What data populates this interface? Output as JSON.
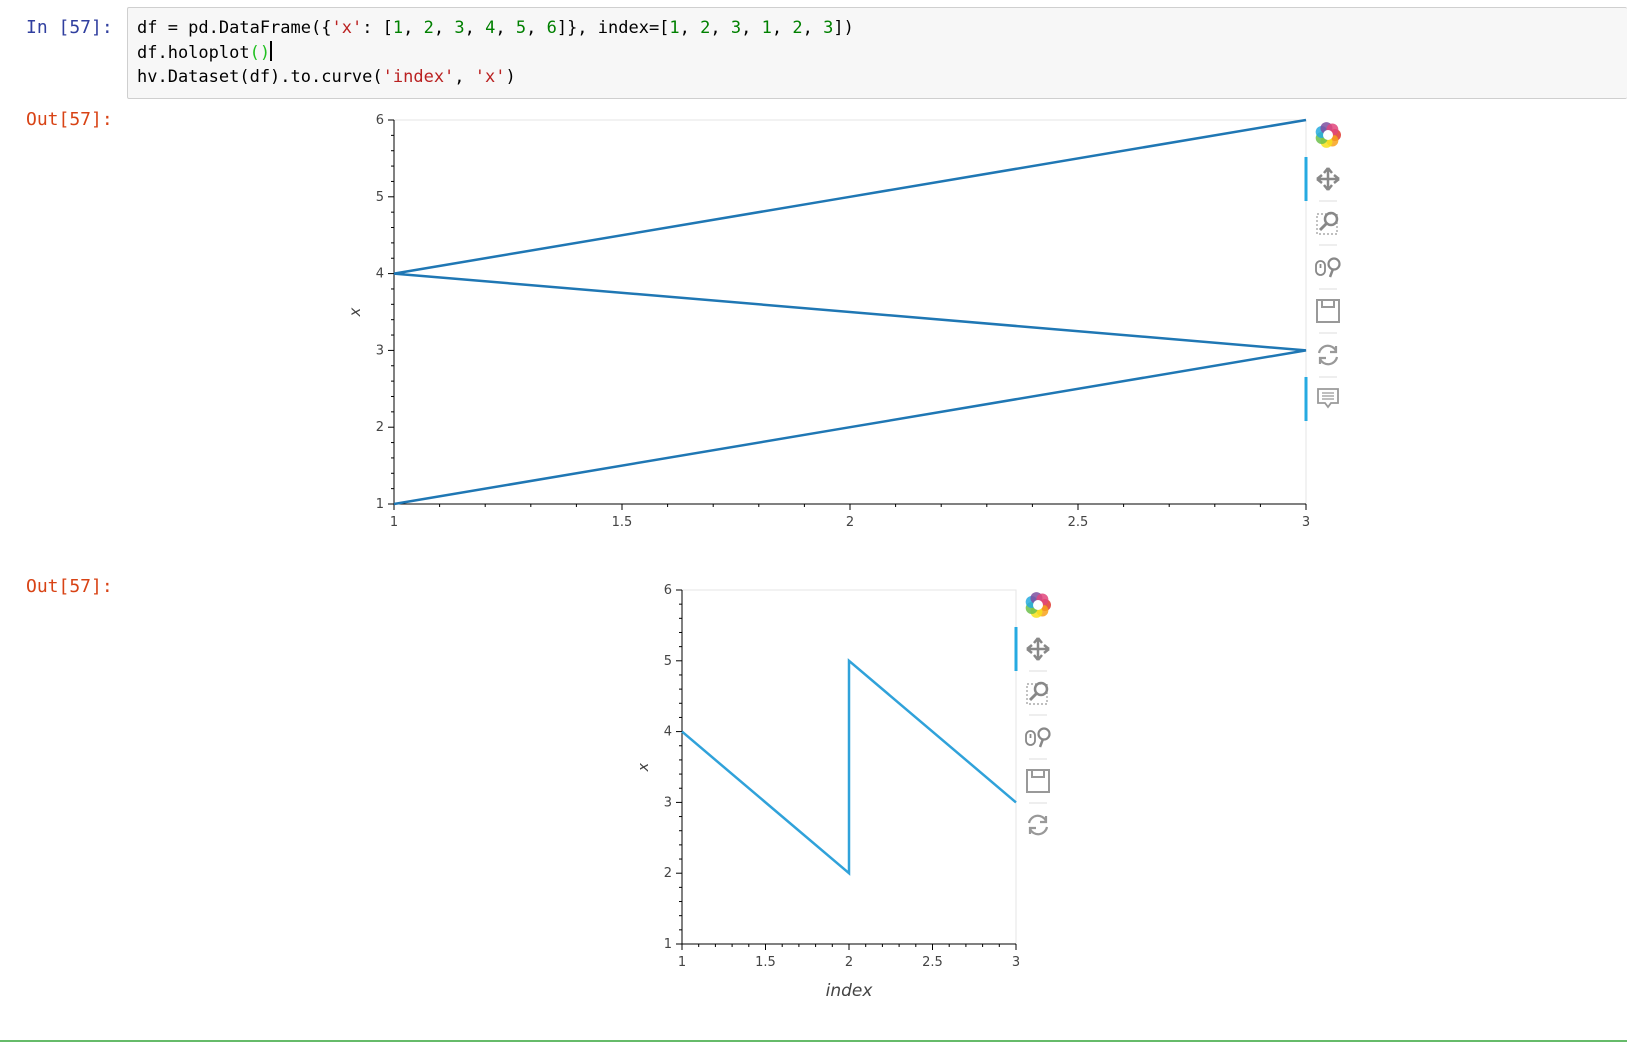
{
  "cell": {
    "in_prompt": "In [57]:",
    "code": {
      "l1_a": "df = pd.DataFrame({",
      "l1_str": "'x'",
      "l1_b": ": [",
      "l1_n1": "1",
      "l1_n2": "2",
      "l1_n3": "3",
      "l1_n4": "4",
      "l1_n5": "5",
      "l1_n6": "6",
      "l1_c": "]}, index=[",
      "l1_m1": "1",
      "l1_m2": "2",
      "l1_m3": "3",
      "l1_m4": "1",
      "l1_m5": "2",
      "l1_m6": "3",
      "l1_d": "])",
      "l2_a": "df.holoplot",
      "l2_paren": "()",
      "l3_a": "hv.Dataset(df).to.curve(",
      "l3_s1": "'index'",
      "l3_sep": ", ",
      "l3_s2": "'x'",
      "l3_b": ")"
    }
  },
  "outputs": [
    {
      "out_prompt": "Out[57]:"
    },
    {
      "out_prompt": "Out[57]:"
    }
  ],
  "toolbar_icons": [
    "bokeh-logo-icon",
    "pan-icon",
    "box-zoom-icon",
    "wheel-zoom-icon",
    "save-icon",
    "reset-icon",
    "hover-icon"
  ],
  "colors": {
    "line_1": "#1f77b4",
    "line_2": "#30a2da",
    "toolbar_active": "#26aae1",
    "prompt_in": "#303f9f",
    "prompt_out": "#d84315"
  },
  "chart_data": [
    {
      "type": "line",
      "x": [
        1,
        2,
        3,
        1,
        2,
        3
      ],
      "series": [
        {
          "values": [
            1,
            2,
            3,
            4,
            5,
            6
          ]
        }
      ],
      "ylabel": "x",
      "xlabel": "",
      "xlim": [
        1,
        3
      ],
      "ylim": [
        1,
        6
      ],
      "xticks": [
        "1",
        "1.5",
        "2",
        "2.5",
        "3"
      ],
      "yticks": [
        "1",
        "2",
        "3",
        "4",
        "5",
        "6"
      ],
      "grid": false
    },
    {
      "type": "line",
      "x": [
        1,
        2,
        2,
        3
      ],
      "series": [
        {
          "values": [
            4,
            2,
            5,
            3
          ]
        }
      ],
      "ylabel": "x",
      "xlabel": "index",
      "xlim": [
        1,
        3
      ],
      "ylim": [
        1,
        6
      ],
      "xticks": [
        "1",
        "1.5",
        "2",
        "2.5",
        "3"
      ],
      "yticks": [
        "1",
        "2",
        "3",
        "4",
        "5",
        "6"
      ],
      "grid": false
    }
  ]
}
